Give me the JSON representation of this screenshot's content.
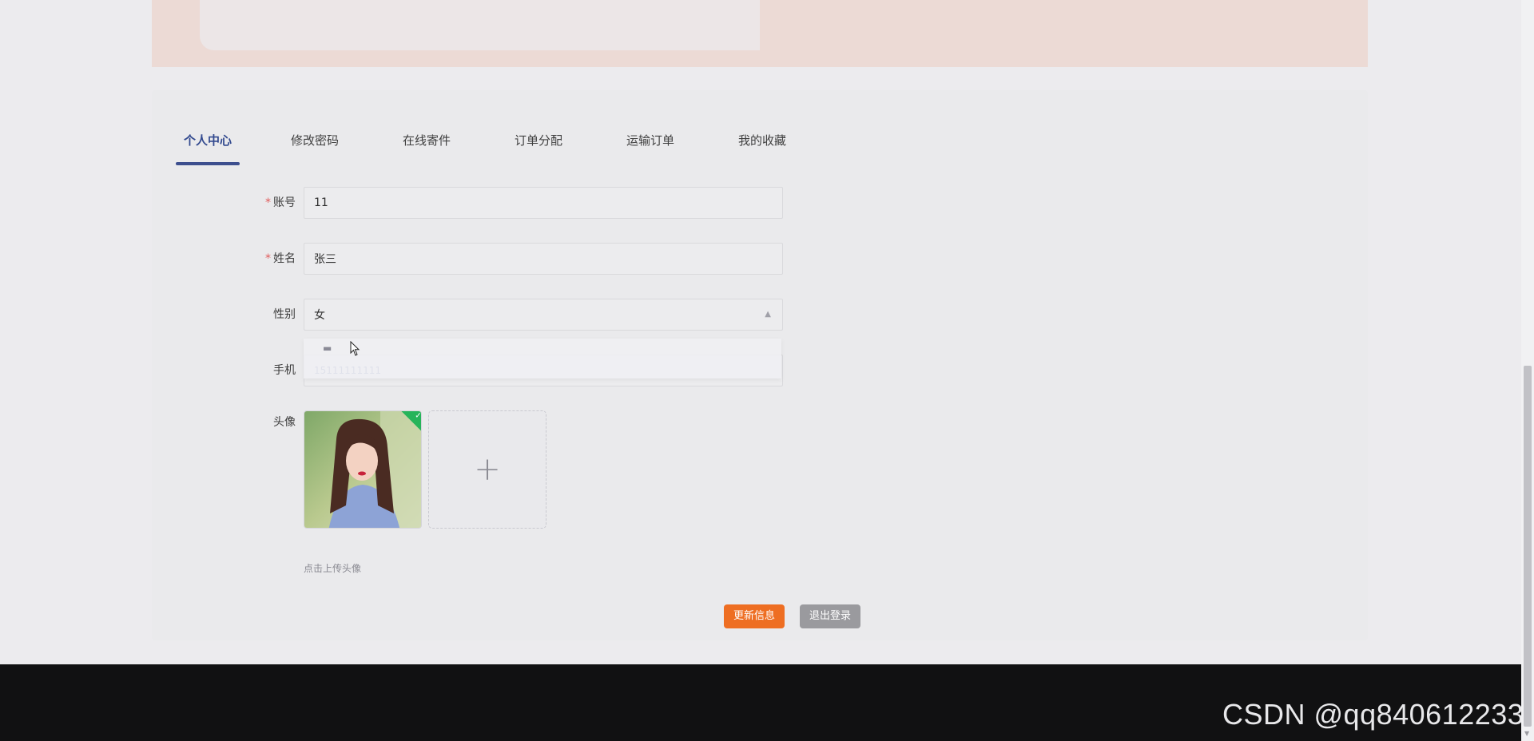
{
  "tabs": [
    {
      "label": "个人中心",
      "active": true
    },
    {
      "label": "修改密码",
      "active": false
    },
    {
      "label": "在线寄件",
      "active": false
    },
    {
      "label": "订单分配",
      "active": false
    },
    {
      "label": "运输订单",
      "active": false
    },
    {
      "label": "我的收藏",
      "active": false
    }
  ],
  "form": {
    "account": {
      "label": "账号",
      "required": true,
      "value": "11"
    },
    "name": {
      "label": "姓名",
      "required": true,
      "value": "张三"
    },
    "gender": {
      "label": "性别",
      "required": false,
      "value": "女"
    },
    "phone": {
      "label": "手机",
      "required": false,
      "value": "15111111111"
    },
    "avatar": {
      "label": "头像",
      "tip": "点击上传头像"
    }
  },
  "required_mark": "*",
  "upload_plus": "+",
  "buttons": {
    "update": "更新信息",
    "logout": "退出登录"
  },
  "watermark": "CSDN @qq840612233",
  "colors": {
    "active_tab": "#334a8f",
    "update_button": "#ee6e22",
    "logout_button": "#9a9a9e",
    "footer": "#111112",
    "success_badge": "#26b45a"
  }
}
